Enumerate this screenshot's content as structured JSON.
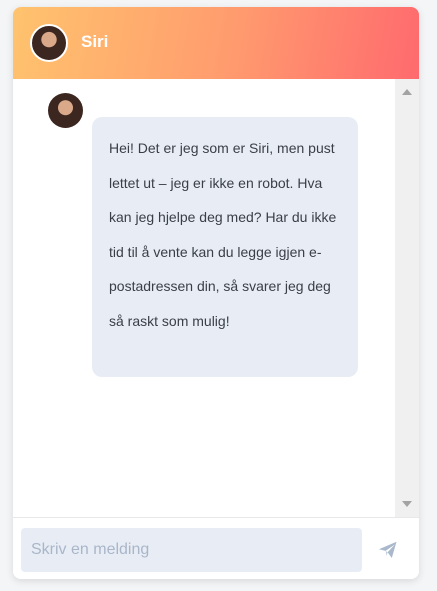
{
  "header": {
    "title": "Siri",
    "avatar_icon": "user-avatar-icon"
  },
  "messages": [
    {
      "sender": "Siri",
      "avatar_icon": "user-avatar-icon",
      "text": "Hei! Det er jeg som er Siri, men pust lettet ut – jeg er ikke en robot. Hva kan jeg hjelpe deg med? Har du ikke tid til å vente kan du legge igjen e-postadressen din, så svarer jeg deg så raskt som mulig!"
    }
  ],
  "composer": {
    "value": "",
    "placeholder": "Skriv en melding",
    "send_icon": "paper-plane-icon"
  },
  "colors": {
    "header_gradient_start": "#ffc36e",
    "header_gradient_end": "#ff6a6e",
    "bubble_bg": "#e8edf5",
    "send_icon": "#aab8cc"
  }
}
